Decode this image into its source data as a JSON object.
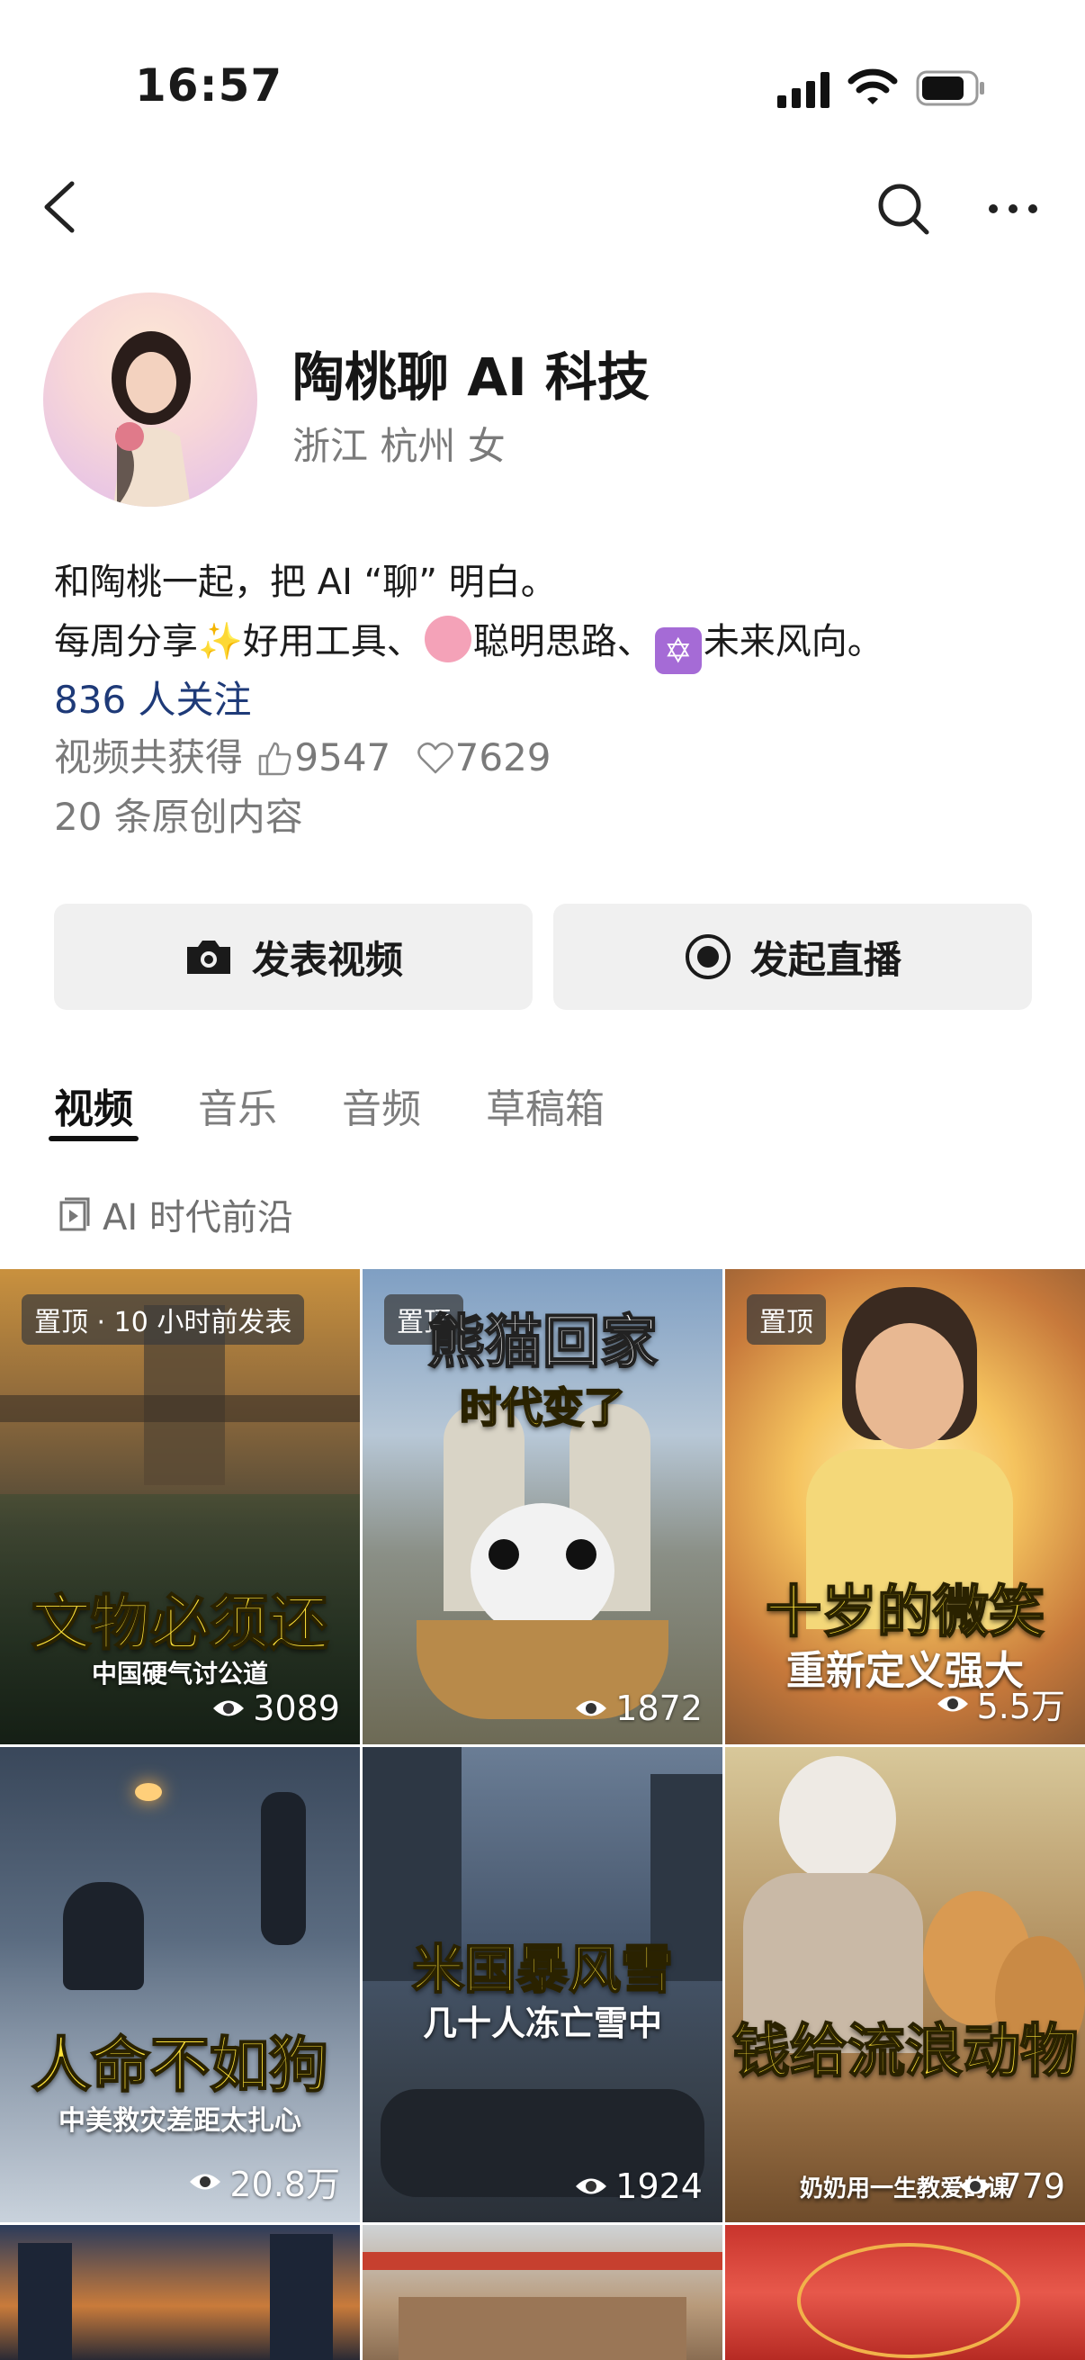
{
  "status_bar": {
    "time": "16:57"
  },
  "icons": {
    "back": "chevron-left-icon",
    "search": "search-icon",
    "more": "more-dots-icon",
    "camera": "camera-icon",
    "live": "live-record-icon",
    "like": "thumb-up-icon",
    "heart": "heart-icon",
    "play": "play-icon",
    "eye": "eye-icon"
  },
  "profile": {
    "name": "陶桃聊 AI 科技",
    "location": "浙江 杭州 女",
    "bio_line1": "和陶桃一起，把 AI “聊” 明白。",
    "bio_line2_part1": "每周分享",
    "bio_line2_part2": "好用工具、",
    "bio_line2_part3": "聪明思路、",
    "bio_line2_part4": "未来风向。",
    "followers": "836 人关注",
    "stats_label": "视频共获得",
    "likes": "9547",
    "hearts": "7629",
    "originals": "20 条原创内容"
  },
  "actions": {
    "post_video": "发表视频",
    "go_live": "发起直播"
  },
  "tabs": [
    "视频",
    "音乐",
    "音频",
    "草稿箱"
  ],
  "active_tab": "视频",
  "collection": {
    "label": "AI 时代前沿"
  },
  "videos": [
    {
      "badge": "置顶 · 10 小时前发表",
      "headline": "文物必须还",
      "subline": "中国硬气讨公道",
      "views": "3089"
    },
    {
      "badge": "置顶",
      "headline": "熊猫回家",
      "subline": "时代变了",
      "views": "1872"
    },
    {
      "badge": "置顶",
      "headline": "十岁的微笑",
      "subline": "重新定义强大",
      "views": "5.5万"
    },
    {
      "badge": "",
      "headline": "人命不如狗",
      "subline": "中美救灾差距太扎心",
      "views": "20.8万"
    },
    {
      "badge": "",
      "headline": "米国暴风雪",
      "subline": "几十人冻亡雪中",
      "views": "1924"
    },
    {
      "badge": "",
      "headline": "钱给流浪动物",
      "subline": "奶奶用一生教爱的课",
      "views": "779"
    }
  ],
  "colors": {
    "link": "#1e3a78",
    "secondary_text": "#7a7a7a",
    "button_bg": "#f0f0f0",
    "headline_yellow": "#ffe33a"
  }
}
